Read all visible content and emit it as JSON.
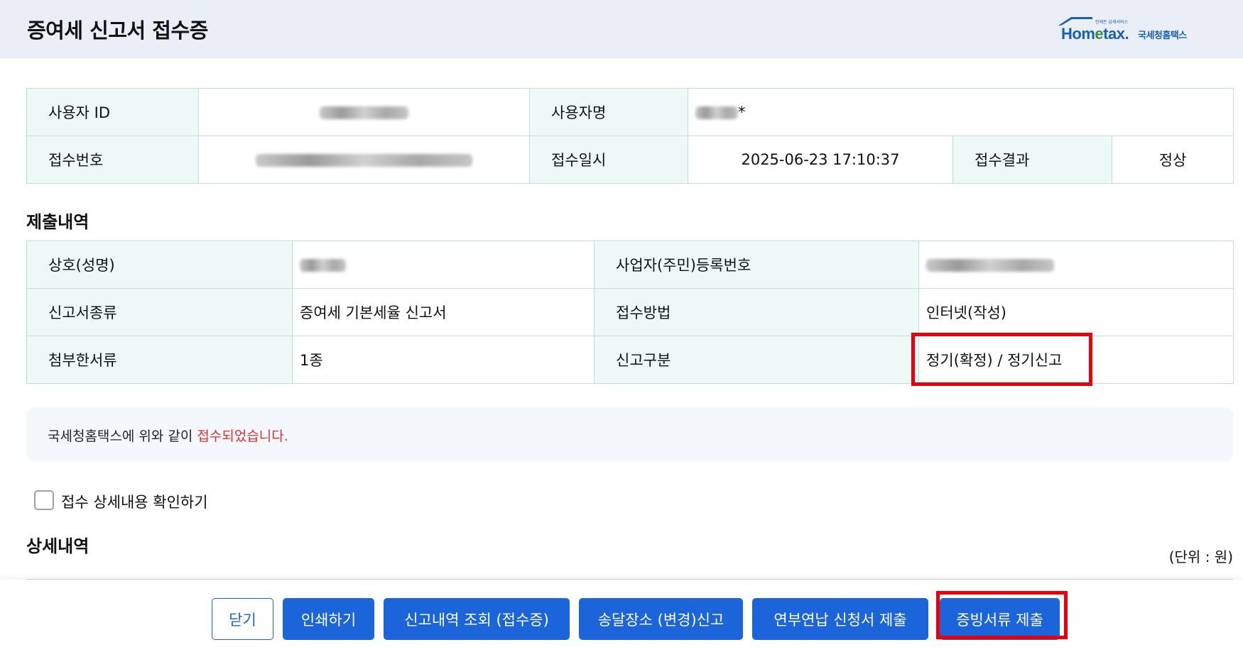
{
  "header": {
    "title": "증여세 신고서 접수증",
    "logo_brand_a": "Hom",
    "logo_brand_e": "e",
    "logo_brand_b": "tax.",
    "logo_tiny": "언제든 납세서비스",
    "logo_name": "국세청홈택스"
  },
  "receipt": {
    "user_id_label": "사용자 ID",
    "user_name_label": "사용자명",
    "user_name_suffix": "*",
    "receipt_no_label": "접수번호",
    "receipt_datetime_label": "접수일시",
    "receipt_datetime": "2025-06-23 17:10:37",
    "receipt_result_label": "접수결과",
    "receipt_result": "정상"
  },
  "submission": {
    "title": "제출내역",
    "name_label": "상호(성명)",
    "reg_no_label": "사업자(주민)등록번호",
    "form_type_label": "신고서종류",
    "form_type": "증여세 기본세율 신고서",
    "method_label": "접수방법",
    "method": "인터넷(작성)",
    "attached_label": "첨부한서류",
    "attached": "1종",
    "category_label": "신고구분",
    "category": "정기(확정) / 정기신고"
  },
  "notice": {
    "text": "국세청홈택스에 위와 같이 ",
    "highlight": "접수되었습니다."
  },
  "detail_check_label": "접수 상세내용 확인하기",
  "detail": {
    "title": "상세내역",
    "unit": "(단위 : 원)"
  },
  "buttons": {
    "close": "닫기",
    "print": "인쇄하기",
    "history": "신고내역 조회 (접수증)",
    "address": "송달장소 (변경)신고",
    "installment": "연부연납 신청서 제출",
    "evidence": "증빙서류 제출"
  },
  "colors": {
    "primary": "#1b64da",
    "highlight_box": "#e8000b",
    "label_bg": "#eef8f7",
    "notice_red": "#e03131"
  }
}
